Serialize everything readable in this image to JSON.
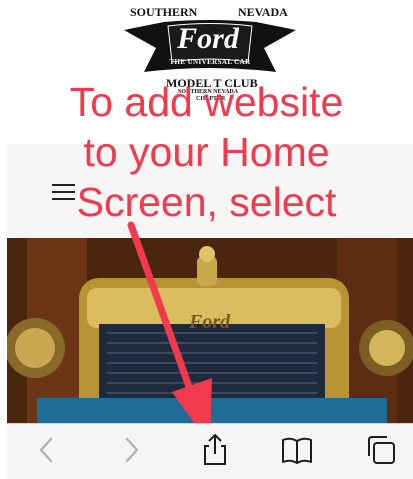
{
  "logo": {
    "top_left": "SOUTHERN",
    "top_right": "NEVADA",
    "brand": "Ford",
    "tagline": "THE UNIVERSAL CAR",
    "club_name": "MODEL T CLUB",
    "sub_line1": "SOUTHERN NEVADA",
    "sub_line2": "CHAPTER"
  },
  "instruction": {
    "line1": "To add website",
    "line2": "to your Home",
    "line3": "Screen, select",
    "color": "#f23a4e"
  },
  "header": {
    "menu_icon": "hamburger-menu-icon"
  },
  "toolbar": {
    "back_icon": "chevron-left-icon",
    "forward_icon": "chevron-right-icon",
    "share_icon": "share-icon",
    "bookmarks_icon": "book-icon",
    "tabs_icon": "tabs-icon",
    "accent": "#007aff"
  }
}
